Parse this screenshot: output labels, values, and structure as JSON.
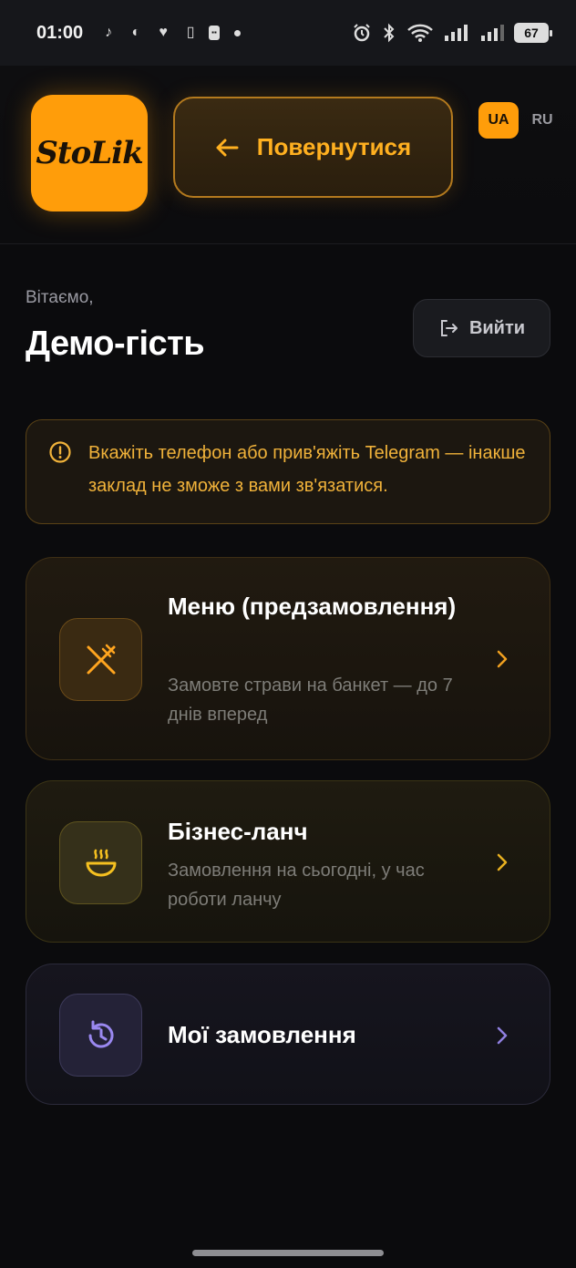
{
  "status_bar": {
    "time": "01:00",
    "battery": "67"
  },
  "header": {
    "logo_text": "StoLik",
    "back_label": "Повернутися",
    "languages": [
      "UA",
      "RU"
    ],
    "active_language": "UA"
  },
  "greeting": {
    "welcome": "Вітаємо,",
    "name": "Демо-гість",
    "logout_label": "Вийти"
  },
  "warning": {
    "text": "Вкажіть телефон або прив'яжіть Telegram — інакше заклад не зможе з вами зв'язатися."
  },
  "cards": [
    {
      "title": "Меню (предзамовлення)",
      "description": "Замовте страви на банкет — до 7 днів вперед",
      "icon": "cutlery-crossed-icon"
    },
    {
      "title": "Бізнес-ланч",
      "description": "Замовлення на сьогодні, у час роботи ланчу",
      "icon": "soup-bowl-icon"
    },
    {
      "title": "Мої замовлення",
      "description": "",
      "icon": "history-icon"
    }
  ],
  "colors": {
    "accent": "#ff9d0a",
    "warning_text": "#f0b23a",
    "orders_accent": "#8f7fe0"
  }
}
